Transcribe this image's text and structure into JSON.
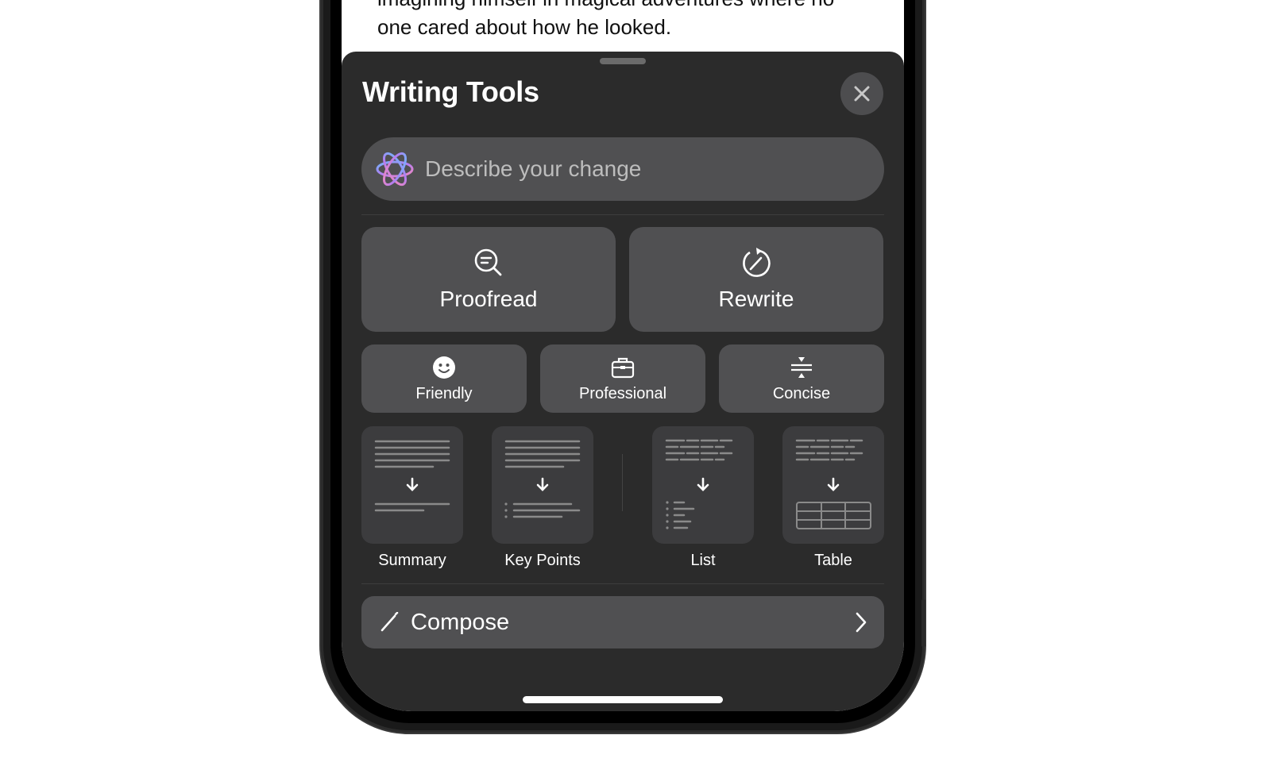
{
  "document": {
    "lines": [
      "imagining himself in magical adventures where no",
      "one cared about how he looked."
    ]
  },
  "sheet": {
    "title": "Writing Tools",
    "close_icon": "close-icon",
    "search": {
      "placeholder": "Describe your change",
      "value": "",
      "icon": "apple-intelligence-icon"
    },
    "primary_actions": [
      {
        "label": "Proofread",
        "icon": "magnifier-text-icon"
      },
      {
        "label": "Rewrite",
        "icon": "rewrite-cycle-icon"
      }
    ],
    "tone_actions": [
      {
        "label": "Friendly",
        "icon": "smiley-icon"
      },
      {
        "label": "Professional",
        "icon": "briefcase-icon"
      },
      {
        "label": "Concise",
        "icon": "compress-icon"
      }
    ],
    "transform_actions": [
      {
        "label": "Summary",
        "icon": "summary-preview-icon"
      },
      {
        "label": "Key Points",
        "icon": "key-points-preview-icon"
      },
      {
        "label": "List",
        "icon": "list-preview-icon"
      },
      {
        "label": "Table",
        "icon": "table-preview-icon"
      }
    ],
    "compose": {
      "label": "Compose",
      "icon": "pencil-icon",
      "chevron": "chevron-right-icon"
    }
  },
  "colors": {
    "sheet_bg": "#2b2b2b",
    "button_bg": "#505052",
    "card_bg": "#3c3c3e",
    "text": "#ffffff",
    "placeholder": "#bdbdbd"
  }
}
